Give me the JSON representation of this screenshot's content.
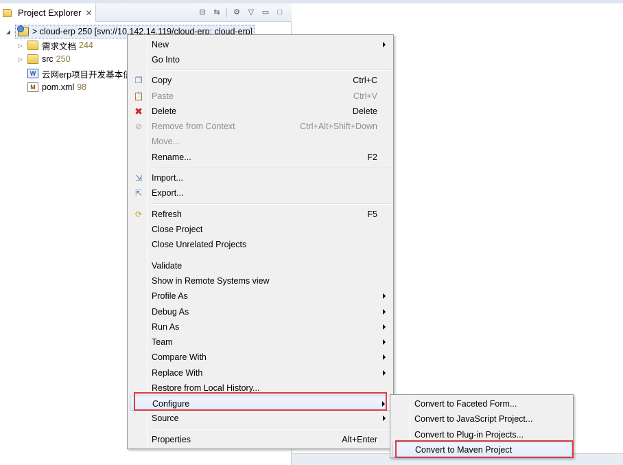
{
  "explorer": {
    "tab_title": "Project Explorer",
    "tab_close": "✕",
    "toolbar_icons": [
      "collapse-all-icon",
      "link-with-editor-icon",
      "filters-icon",
      "view-menu-icon",
      "minimize-icon",
      "maximize-icon"
    ]
  },
  "tree": {
    "project": {
      "label": "> cloud-erp  250 [svn://10.142.14.119/cloud-erp: cloud-erp]"
    },
    "items": [
      {
        "name": "需求文档",
        "rev": "244",
        "icon": "folder-icon",
        "expandable": true
      },
      {
        "name": "src",
        "rev": "250",
        "icon": "folder-icon",
        "expandable": true
      },
      {
        "name": "云网erp项目开发基本信",
        "rev": "",
        "icon": "word-file-icon",
        "expandable": false
      },
      {
        "name": "pom.xml",
        "rev": "98",
        "icon": "xml-file-icon",
        "expandable": false
      }
    ]
  },
  "context_menu": {
    "new": "New",
    "go_into": "Go Into",
    "copy": "Copy",
    "copy_sc": "Ctrl+C",
    "paste": "Paste",
    "paste_sc": "Ctrl+V",
    "delete": "Delete",
    "delete_sc": "Delete",
    "remove_context": "Remove from Context",
    "remove_context_sc": "Ctrl+Alt+Shift+Down",
    "move": "Move...",
    "rename": "Rename...",
    "rename_sc": "F2",
    "import": "Import...",
    "export": "Export...",
    "refresh": "Refresh",
    "refresh_sc": "F5",
    "close_project": "Close Project",
    "close_unrelated": "Close Unrelated Projects",
    "validate": "Validate",
    "show_remote": "Show in Remote Systems view",
    "profile_as": "Profile As",
    "debug_as": "Debug As",
    "run_as": "Run As",
    "team": "Team",
    "compare_with": "Compare With",
    "replace_with": "Replace With",
    "restore_history": "Restore from Local History...",
    "configure": "Configure",
    "source": "Source",
    "properties": "Properties",
    "properties_sc": "Alt+Enter"
  },
  "configure_submenu": {
    "faceted": "Convert to Faceted Form...",
    "javascript": "Convert to JavaScript Project...",
    "plugin": "Convert to Plug-in Projects...",
    "maven": "Convert to Maven Project"
  },
  "colors": {
    "highlight": "#e03c3c",
    "menu_bg": "#f0f0f0",
    "hover_border": "#aeccf0"
  }
}
